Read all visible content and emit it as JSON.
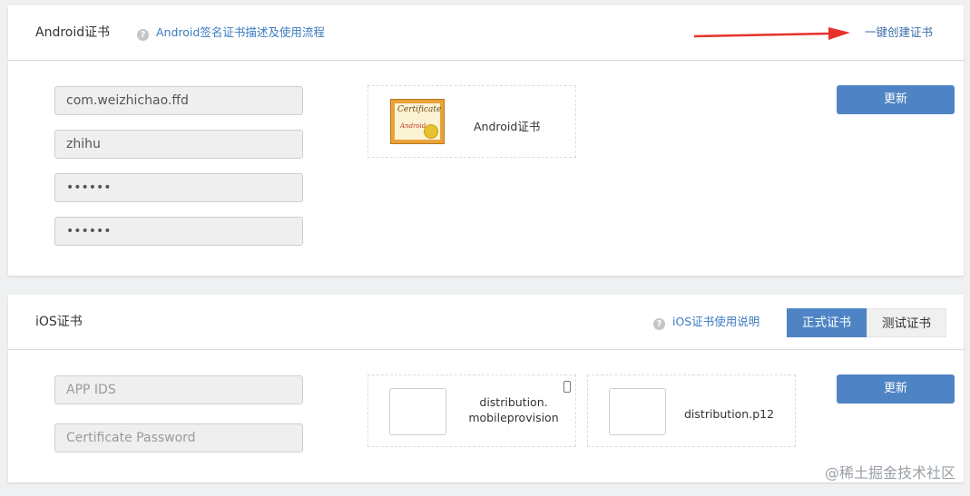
{
  "android": {
    "title": "Android证书",
    "help_link": "Android签名证书描述及使用流程",
    "quick_create": "一键创建证书",
    "fields": [
      "com.weizhichao.ffd",
      "zhihu",
      "••••••",
      "••••••"
    ],
    "cert_label": "Android证书",
    "cert_image_text": "Certificate",
    "cert_image_sub": "Android",
    "update_button": "更新"
  },
  "ios": {
    "title": "iOS证书",
    "help_link": "iOS证书使用说明",
    "tabs": [
      "正式证书",
      "测试证书"
    ],
    "app_ids_placeholder": "APP IDS",
    "password_placeholder": "Certificate Password",
    "provision_label_line1": "distribution.",
    "provision_label_line2": "mobileprovision",
    "p12_label": "distribution.p12",
    "update_button": "更新"
  },
  "watermark": "@稀土掘金技术社区",
  "colors": {
    "accent": "#4f84c4",
    "link": "#3b7bbf",
    "arrow": "#e8312a"
  }
}
